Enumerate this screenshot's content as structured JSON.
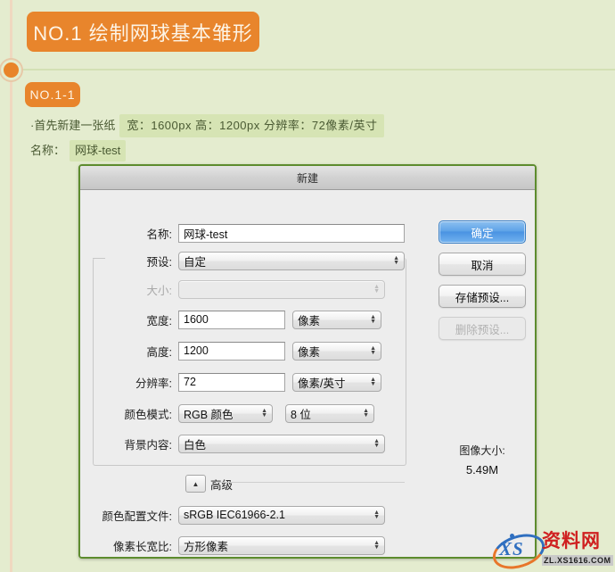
{
  "page": {
    "background_color": "#e4eccf",
    "accent_color": "#e8852c",
    "divider_color": "#d3e0b4"
  },
  "timeline": {
    "dot_name": "timeline-node"
  },
  "heading": {
    "badge_label": "NO.1 绘制网球基本雏形"
  },
  "step": {
    "badge_label": "NO.1-1"
  },
  "caption": {
    "lead": "·首先新建一张纸",
    "spec": "宽：1600px 高：1200px 分辨率：72像素/英寸",
    "name_label": "名称：",
    "name_value": "网球-test"
  },
  "dialog": {
    "title": "新建",
    "fields": {
      "name_label": "名称:",
      "name_value": "网球-test",
      "preset_label": "预设:",
      "preset_value": "自定",
      "size_label": "大小:",
      "size_value": "",
      "width_label": "宽度:",
      "width_value": "1600",
      "width_unit": "像素",
      "height_label": "高度:",
      "height_value": "1200",
      "height_unit": "像素",
      "resolution_label": "分辨率:",
      "resolution_value": "72",
      "resolution_unit": "像素/英寸",
      "colormode_label": "颜色模式:",
      "colormode_value": "RGB 颜色",
      "colordepth_value": "8 位",
      "background_label": "背景内容:",
      "background_value": "白色",
      "advanced_label": "高级",
      "colorprofile_label": "颜色配置文件:",
      "colorprofile_value": "sRGB IEC61966-2.1",
      "pixelaspect_label": "像素长宽比:",
      "pixelaspect_value": "方形像素"
    },
    "buttons": {
      "ok": "确定",
      "cancel": "取消",
      "save_preset": "存储预设...",
      "delete_preset": "删除预设..."
    },
    "image_size": {
      "label": "图像大小:",
      "value": "5.49M"
    }
  },
  "watermark": {
    "logo_text": "XS",
    "brand": "资料网",
    "url": "ZL.XS1616.COM"
  }
}
